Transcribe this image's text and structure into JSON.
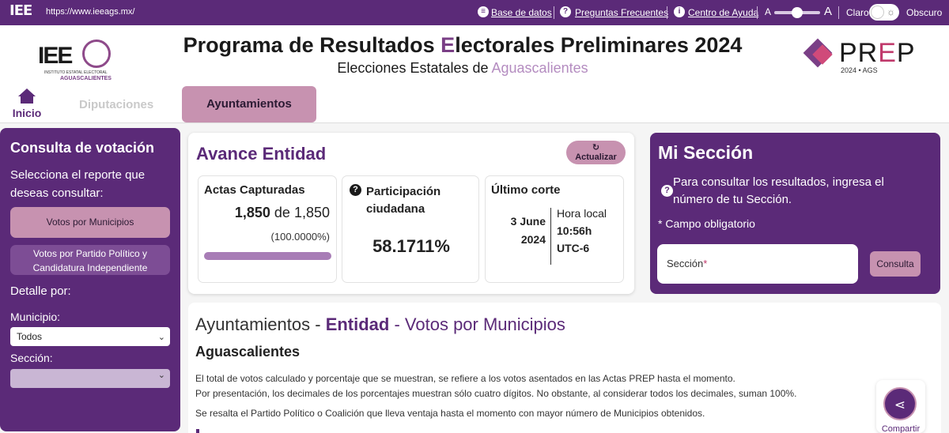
{
  "topbar": {
    "logo": "IEE",
    "url": "https://www.ieeags.mx/",
    "links": [
      "Base de datos",
      "Preguntas Frecuentes",
      "Centro de Ayuda"
    ],
    "font_small": "A",
    "font_large": "A",
    "theme_light": "Claro",
    "theme_dark": "Obscuro"
  },
  "header": {
    "logo_text": "IEE",
    "logo_line1": "INSTITUTO ESTATAL ELECTORAL",
    "logo_line2": "AGUASCALIENTES",
    "title_pre": "Programa de Resultados ",
    "title_e": "E",
    "title_post": "lectorales Preliminares 2024",
    "subtitle_pre": "Elecciones Estatales de ",
    "subtitle_place": "Aguascalientes",
    "prep_p1": "PR",
    "prep_e": "E",
    "prep_p2": "P",
    "prep_year": "2024 • AGS"
  },
  "nav": {
    "home": "Inicio",
    "tab_diputaciones": "Diputaciones",
    "tab_ayuntamientos": "Ayuntamientos"
  },
  "sidebar": {
    "title": "Consulta de votación",
    "prompt": "Selecciona el reporte que deseas consultar:",
    "btn_municipios": "Votos por Municipios",
    "btn_partido_line1": "Votos por Partido Político y",
    "btn_partido_line2": "Candidatura Independiente",
    "detalle": "Detalle por:",
    "municipio_label": "Municipio:",
    "municipio_value": "Todos",
    "seccion_label": "Sección:"
  },
  "avance": {
    "title": "Avance Entidad",
    "refresh": "Actualizar",
    "actas_title": "Actas Capturadas",
    "actas_captured": "1,850",
    "actas_of": "de",
    "actas_total": "1,850",
    "actas_pct": "(100.0000%)",
    "actas_progress": 1.0,
    "part_title": "Participación ciudadana",
    "part_value": "58.1711%",
    "corte_title": "Último corte",
    "corte_date1": "3 June",
    "corte_date2": "2024",
    "corte_local": "Hora local",
    "corte_time": "10:56h",
    "corte_tz": "UTC-6"
  },
  "mi_seccion": {
    "title": "Mi Sección",
    "text": "Para consultar los resultados, ingresa el número de tu Sección.",
    "required": "* Campo obligatorio",
    "input_label": "Sección",
    "input_star": "*",
    "button": "Consulta"
  },
  "lower": {
    "h_pre": "Ayuntamientos - ",
    "h_ent": "Entidad",
    "h_post": " - Votos por Municipios",
    "subtitle": "Aguascalientes",
    "p1a": "El total de votos calculado y porcentaje que se muestran, se refiere a los votos asentados en las Actas PREP hasta el momento.",
    "p1b": "Por presentación, los decimales de los porcentajes muestran sólo cuatro dígitos. No obstante, al considerar todos los decimales, suman 100%.",
    "p2": "Se resalta el Partido Político o Coalición que lleva ventaja hasta el momento con mayor número de Municipios obtenidos.",
    "share": "Compartir"
  },
  "colors": {
    "primary": "#5b2a78",
    "accent": "#c792b0",
    "prep_pink": "#c0396b"
  }
}
